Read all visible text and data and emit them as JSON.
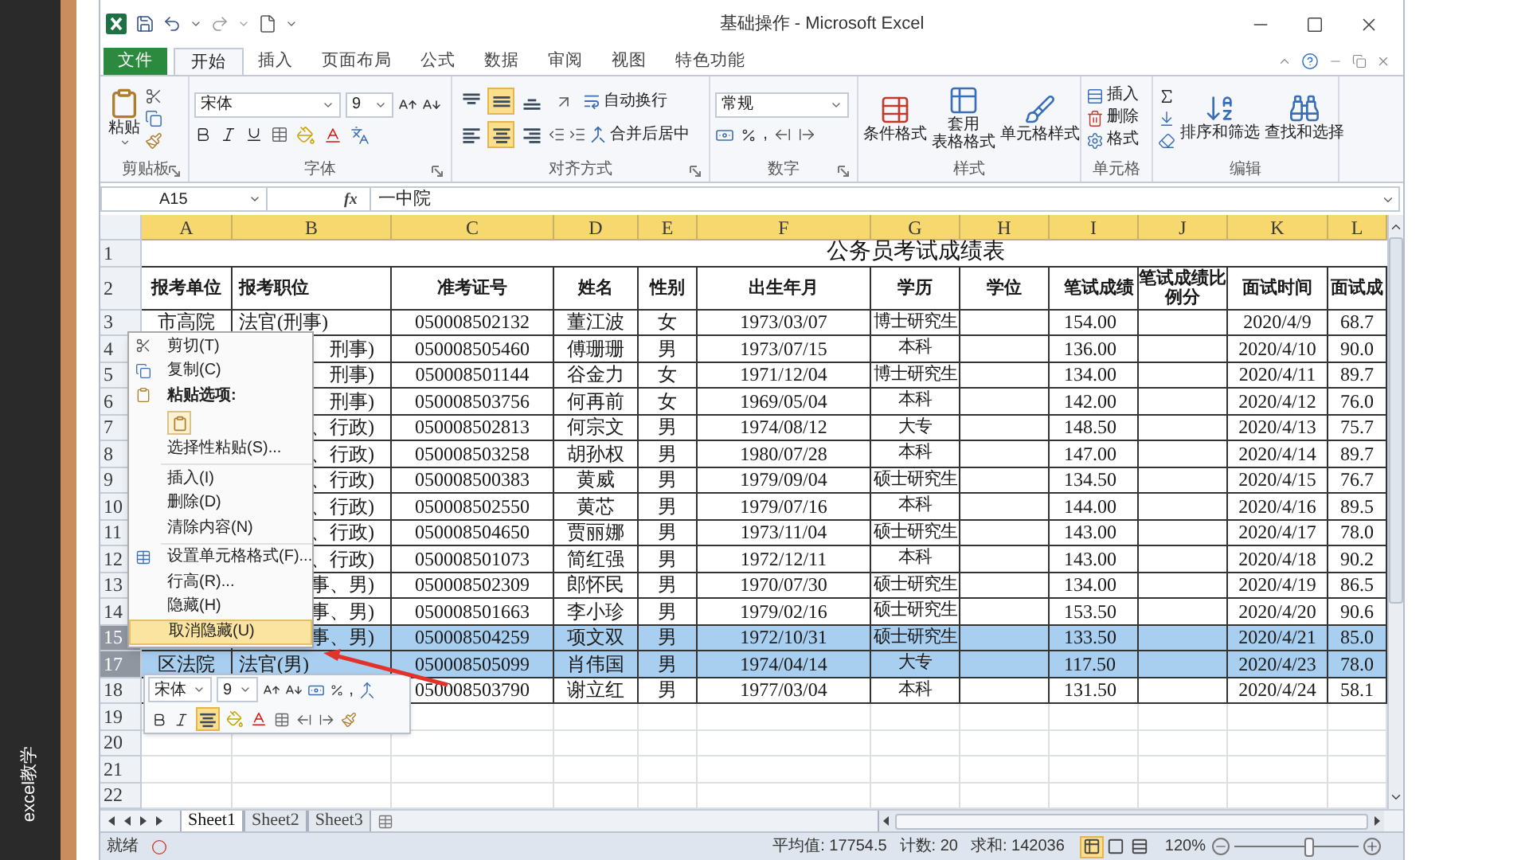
{
  "side_caption": "excel教学",
  "window": {
    "title": "基础操作 - Microsoft Excel"
  },
  "ribbon_tabs": [
    {
      "label": "文件",
      "kind": "file",
      "selected": false
    },
    {
      "label": "开始",
      "kind": "tab",
      "selected": true
    },
    {
      "label": "插入",
      "kind": "tab",
      "selected": false
    },
    {
      "label": "页面布局",
      "kind": "tab",
      "selected": false
    },
    {
      "label": "公式",
      "kind": "tab",
      "selected": false
    },
    {
      "label": "数据",
      "kind": "tab",
      "selected": false
    },
    {
      "label": "审阅",
      "kind": "tab",
      "selected": false
    },
    {
      "label": "视图",
      "kind": "tab",
      "selected": false
    },
    {
      "label": "特色功能",
      "kind": "tab",
      "selected": false
    }
  ],
  "ribbon": {
    "clipboard": {
      "label": "剪贴板",
      "paste": "粘贴"
    },
    "font": {
      "label": "字体",
      "font_name": "宋体",
      "font_size": "9"
    },
    "alignment": {
      "label": "对齐方式",
      "wrap_text": "自动换行",
      "merge": "合并后居中",
      "buttons": [
        {
          "kind": "top",
          "selected": false
        },
        {
          "kind": "middle",
          "selected": true
        },
        {
          "kind": "bottom",
          "selected": false
        },
        {
          "kind": "left",
          "selected": false
        },
        {
          "kind": "center",
          "selected": true
        },
        {
          "kind": "right",
          "selected": false
        }
      ]
    },
    "number": {
      "label": "数字",
      "format": "常规",
      "comma": ","
    },
    "styles": {
      "label": "样式",
      "buttons": [
        {
          "kind": "conditional",
          "lines": [
            "条件格式"
          ]
        },
        {
          "kind": "table",
          "lines": [
            "套用",
            "表格格式"
          ]
        },
        {
          "kind": "cell",
          "lines": [
            "单元格样式"
          ]
        }
      ]
    },
    "cells": {
      "label": "单元格",
      "buttons": [
        {
          "kind": "insert",
          "label": "插入"
        },
        {
          "kind": "delete",
          "label": "删除"
        },
        {
          "kind": "format",
          "label": "格式"
        }
      ]
    },
    "editing": {
      "label": "编辑",
      "buttons": [
        {
          "kind": "sort",
          "label": "排序和筛选"
        },
        {
          "kind": "find",
          "label": "查找和选择"
        }
      ]
    }
  },
  "formula_bar": {
    "name_box": "A15",
    "function_label": "fx",
    "value": "一中院"
  },
  "columns": [
    {
      "label": "A",
      "selected": true
    },
    {
      "label": "B",
      "selected": true
    },
    {
      "label": "C",
      "selected": true
    },
    {
      "label": "D",
      "selected": true
    },
    {
      "label": "E",
      "selected": true
    },
    {
      "label": "F",
      "selected": true
    },
    {
      "label": "G",
      "selected": true
    },
    {
      "label": "H",
      "selected": true
    },
    {
      "label": "I",
      "selected": true
    },
    {
      "label": "J",
      "selected": true
    },
    {
      "label": "K",
      "selected": true
    },
    {
      "label": "L",
      "selected": true
    }
  ],
  "rows": [
    {
      "number": "1",
      "kind": "title",
      "selected": false,
      "title": "公务员考试成绩表"
    },
    {
      "number": "2",
      "kind": "header",
      "selected": false,
      "cells": {
        "A": "报考单位",
        "B": "报考职位",
        "C": "准考证号",
        "D": "姓名",
        "E": "性别",
        "F": "出生年月",
        "G": "学历",
        "H": "学位",
        "I": "笔试成绩",
        "J": "笔试成绩比例分",
        "K": "面试时间",
        "L": "面试成"
      }
    },
    {
      "number": "3",
      "kind": "data",
      "selected": false,
      "cells": {
        "A": "市高院",
        "B": "法官(刑事)",
        "C": "050008502132",
        "D": "董江波",
        "E": "女",
        "F": "1973/03/07",
        "G": "博士研究生",
        "I": "154.00",
        "K": "2020/4/9",
        "L": "68.7"
      }
    },
    {
      "number": "4",
      "kind": "data",
      "selected": false,
      "cells": {
        "B": "刑事)",
        "C": "050008505460",
        "D": "傅珊珊",
        "E": "男",
        "F": "1973/07/15",
        "G": "本科",
        "I": "136.00",
        "K": "2020/4/10",
        "L": "90.0"
      }
    },
    {
      "number": "5",
      "kind": "data",
      "selected": false,
      "cells": {
        "B": "刑事)",
        "C": "050008501144",
        "D": "谷金力",
        "E": "女",
        "F": "1971/12/04",
        "G": "博士研究生",
        "I": "134.00",
        "K": "2020/4/11",
        "L": "89.7"
      }
    },
    {
      "number": "6",
      "kind": "data",
      "selected": false,
      "cells": {
        "B": "刑事)",
        "C": "050008503756",
        "D": "何再前",
        "E": "女",
        "F": "1969/05/04",
        "G": "本科",
        "I": "142.00",
        "K": "2020/4/12",
        "L": "76.0"
      }
    },
    {
      "number": "7",
      "kind": "data",
      "selected": false,
      "cells": {
        "B": "、行政)",
        "C": "050008502813",
        "D": "何宗文",
        "E": "男",
        "F": "1974/08/12",
        "G": "大专",
        "I": "148.50",
        "K": "2020/4/13",
        "L": "75.7"
      }
    },
    {
      "number": "8",
      "kind": "data",
      "selected": false,
      "cells": {
        "B": "、行政)",
        "C": "050008503258",
        "D": "胡孙权",
        "E": "男",
        "F": "1980/07/28",
        "G": "本科",
        "I": "147.00",
        "K": "2020/4/14",
        "L": "89.7"
      }
    },
    {
      "number": "9",
      "kind": "data",
      "selected": false,
      "cells": {
        "B": "、行政)",
        "C": "050008500383",
        "D": "黄威",
        "E": "男",
        "F": "1979/09/04",
        "G": "硕士研究生",
        "I": "134.50",
        "K": "2020/4/15",
        "L": "76.7"
      }
    },
    {
      "number": "10",
      "kind": "data",
      "selected": false,
      "cells": {
        "B": "、行政)",
        "C": "050008502550",
        "D": "黄芯",
        "E": "男",
        "F": "1979/07/16",
        "G": "本科",
        "I": "144.00",
        "K": "2020/4/16",
        "L": "89.5"
      }
    },
    {
      "number": "11",
      "kind": "data",
      "selected": false,
      "cells": {
        "B": "、行政)",
        "C": "050008504650",
        "D": "贾丽娜",
        "E": "男",
        "F": "1973/11/04",
        "G": "硕士研究生",
        "I": "143.00",
        "K": "2020/4/17",
        "L": "78.0"
      }
    },
    {
      "number": "12",
      "kind": "data",
      "selected": false,
      "cells": {
        "B": "、行政)",
        "C": "050008501073",
        "D": "简红强",
        "E": "男",
        "F": "1972/12/11",
        "G": "本科",
        "I": "143.00",
        "K": "2020/4/18",
        "L": "90.2"
      }
    },
    {
      "number": "13",
      "kind": "data",
      "selected": false,
      "cells": {
        "B": "事、男)",
        "C": "050008502309",
        "D": "郎怀民",
        "E": "男",
        "F": "1970/07/30",
        "G": "硕士研究生",
        "I": "134.00",
        "K": "2020/4/19",
        "L": "86.5"
      }
    },
    {
      "number": "14",
      "kind": "data",
      "selected": false,
      "cells": {
        "B": "事、男)",
        "C": "050008501663",
        "D": "李小珍",
        "E": "男",
        "F": "1979/02/16",
        "G": "硕士研究生",
        "I": "153.50",
        "K": "2020/4/20",
        "L": "90.6"
      }
    },
    {
      "number": "15",
      "kind": "data",
      "selected": true,
      "cells": {
        "B": "事、男)",
        "C": "050008504259",
        "D": "项文双",
        "E": "男",
        "F": "1972/10/31",
        "G": "硕士研究生",
        "I": "133.50",
        "K": "2020/4/21",
        "L": "85.0"
      }
    },
    {
      "number": "17",
      "kind": "data",
      "selected": true,
      "cells": {
        "A": "区法院",
        "B": "法官(男)",
        "C": "050008505099",
        "D": "肖伟国",
        "E": "男",
        "F": "1974/04/14",
        "G": "大专",
        "I": "117.50",
        "K": "2020/4/23",
        "L": "78.0"
      }
    },
    {
      "number": "18",
      "kind": "data",
      "selected": false,
      "cells": {
        "C": "050008503790",
        "D": "谢立红",
        "E": "男",
        "F": "1977/03/04",
        "G": "本科",
        "I": "131.50",
        "K": "2020/4/24",
        "L": "58.1"
      }
    },
    {
      "number": "19",
      "kind": "empty",
      "selected": false
    },
    {
      "number": "20",
      "kind": "empty",
      "selected": false
    },
    {
      "number": "21",
      "kind": "empty",
      "selected": false
    },
    {
      "number": "22",
      "kind": "empty",
      "selected": false
    }
  ],
  "context_menu": {
    "items": [
      {
        "kind": "cut",
        "label": "剪切(T)",
        "selected": false
      },
      {
        "kind": "copy",
        "label": "复制(C)",
        "selected": false
      },
      {
        "kind": "heading",
        "label": "粘贴选项:",
        "selected": false
      },
      {
        "kind": "paste-option",
        "selected": false
      },
      {
        "kind": "item",
        "label": "选择性粘贴(S)...",
        "selected": false
      },
      {
        "kind": "separator"
      },
      {
        "kind": "item",
        "label": "插入(I)",
        "selected": false
      },
      {
        "kind": "item",
        "label": "删除(D)",
        "selected": false
      },
      {
        "kind": "item",
        "label": "清除内容(N)",
        "selected": false
      },
      {
        "kind": "separator"
      },
      {
        "kind": "format",
        "label": "设置单元格格式(F)...",
        "selected": false
      },
      {
        "kind": "item",
        "label": "行高(R)...",
        "selected": false
      },
      {
        "kind": "item",
        "label": "隐藏(H)",
        "selected": false
      },
      {
        "kind": "item",
        "label": "取消隐藏(U)",
        "selected": true
      }
    ]
  },
  "mini_toolbar": {
    "font_name": "宋体",
    "font_size": "9",
    "comma": ",",
    "align_center": {
      "selected": true
    }
  },
  "sheet_tabs": [
    {
      "label": "Sheet1",
      "selected": true
    },
    {
      "label": "Sheet2",
      "selected": false
    },
    {
      "label": "Sheet3",
      "selected": false
    }
  ],
  "status_bar": {
    "ready": "就绪",
    "average": "平均值: 17754.5",
    "count": "计数: 20",
    "sum": "求和: 142036",
    "views": [
      {
        "kind": "normal",
        "selected": true
      },
      {
        "kind": "layout",
        "selected": false
      },
      {
        "kind": "break",
        "selected": false
      }
    ],
    "zoom": "120%",
    "zoom_slider": {
      "level": 0.6
    }
  }
}
